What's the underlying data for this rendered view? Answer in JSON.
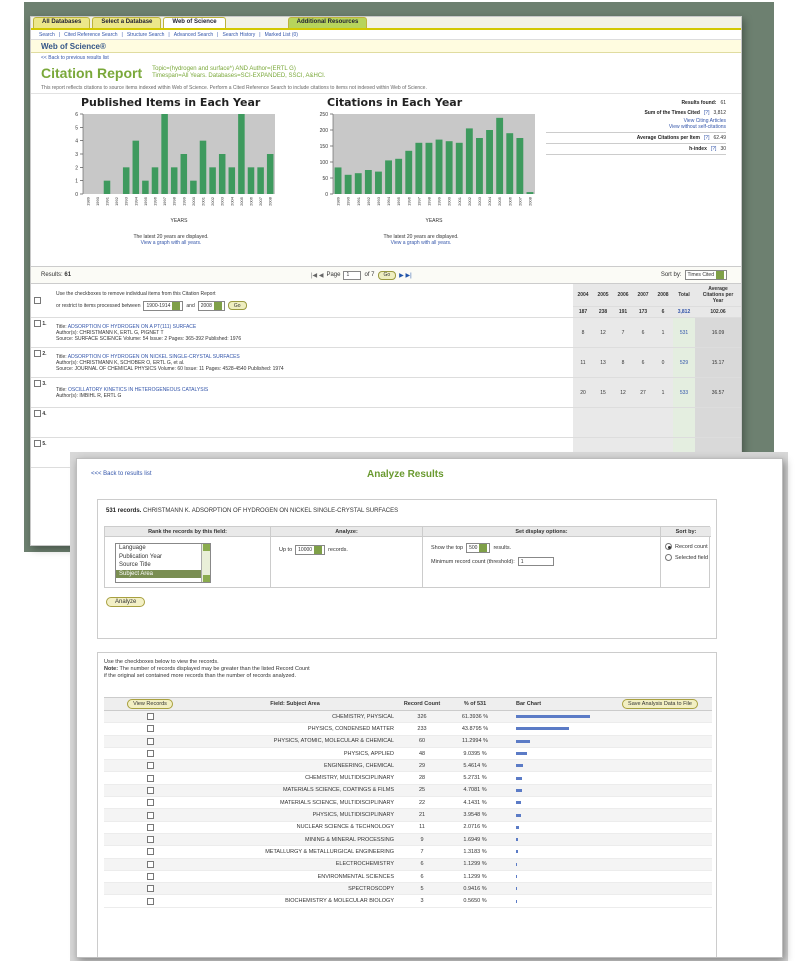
{
  "back": {
    "tabs": [
      "All Databases",
      "Select a Database",
      "Web of Science",
      "Additional Resources"
    ],
    "links": [
      "Search",
      "Cited Reference Search",
      "Structure Search",
      "Advanced Search",
      "Search History",
      "Marked List (0)"
    ],
    "section_title": "Web of Science®",
    "back_link": "<< Back to previous results list",
    "report_title": "Citation Report",
    "topic_line1": "Topic=(hydrogen and surface*) AND Author=(ERTL G)",
    "topic_line2": "Timespan=All Years. Databases=SCI-EXPANDED, SSCI, A&HCI.",
    "note": "This report reflects citations to source items indexed within Web of Science. Perform a Cited Reference Search to include citations to items not indexed within Web of Science.",
    "published": {
      "title": "Published Items in Each Year",
      "foot1": "The latest 20 years are displayed.",
      "foot2": "View a graph with all years.",
      "xlabel": "YEARS"
    },
    "citations": {
      "title": "Citations in Each Year",
      "foot1": "The latest 20 years are displayed.",
      "foot2": "View a graph with all years.",
      "xlabel": "YEARS"
    },
    "stats": {
      "results_label": "Results found:",
      "results_value": "61",
      "sum_label": "Sum of the Times Cited",
      "sum_link": "[?]",
      "sum_value": "3,812",
      "view_citing": "View Citing Articles",
      "view_without": "View without self-citations",
      "avg_label": "Average Citations per Item",
      "avg_link": "[?]",
      "avg_value": "62.49",
      "h_label": "h-index",
      "h_link": "[?]",
      "h_value": "30"
    },
    "pager": {
      "results_label": "Results:",
      "results_value": "61",
      "page_label": "Page",
      "page_value": "1",
      "of": "of 7",
      "go": "Go",
      "sort_label": "Sort by:",
      "sort_value": "Times Cited"
    },
    "table": {
      "years": [
        "2004",
        "2005",
        "2006",
        "2007",
        "2008"
      ],
      "total_label": "Total",
      "avg_label": "Average Citations per Year",
      "instr1": "Use the checkboxes to remove individual items from this Citation Report",
      "instr2": "or restrict to items processed between",
      "from_year": "1900-1914",
      "and": "and",
      "to_year": "2008",
      "go": "Go",
      "totals": [
        "187",
        "238",
        "191",
        "173",
        "6",
        "3,812",
        "102.06"
      ],
      "records": [
        {
          "num": "1.",
          "title_label": "Title:",
          "title": "ADSORPTION OF HYDROGEN ON A PT(111) SURFACE",
          "authors_label": "Author(s):",
          "authors": "CHRISTMANN K, ERTL G, PIGNET T",
          "source_label": "Source:",
          "source": "SURFACE SCIENCE Volume: 54 Issue: 2 Pages: 365-392 Published: 1976",
          "vals": [
            "8",
            "12",
            "7",
            "6",
            "1",
            "531",
            "16.09"
          ]
        },
        {
          "num": "2.",
          "title_label": "Title:",
          "title": "ADSORPTION OF HYDROGEN ON NICKEL SINGLE-CRYSTAL SURFACES",
          "authors_label": "Author(s):",
          "authors": "CHRISTMANN K, SCHOBER O, ERTL G, et al.",
          "source_label": "Source:",
          "source": "JOURNAL OF CHEMICAL PHYSICS Volume: 60 Issue: 11 Pages: 4528-4540 Published: 1974",
          "vals": [
            "11",
            "13",
            "8",
            "6",
            "0",
            "529",
            "15.17"
          ]
        },
        {
          "num": "3.",
          "title_label": "Title:",
          "title": "OSCILLATORY KINETICS IN HETEROGENEOUS CATALYSIS",
          "authors_label": "Author(s):",
          "authors": "IMBIHL R, ERTL G",
          "source_label": "",
          "source": "",
          "vals": [
            "20",
            "15",
            "12",
            "27",
            "1",
            "533",
            "36.57"
          ]
        },
        {
          "num": "4.",
          "title_label": "",
          "title": "",
          "authors_label": "",
          "authors": "",
          "source_label": "",
          "source": "",
          "vals": [
            "",
            "",
            "",
            "",
            "",
            "",
            ""
          ]
        },
        {
          "num": "5.",
          "title_label": "",
          "title": "",
          "authors_label": "",
          "authors": "",
          "source_label": "",
          "source": "",
          "vals": [
            "",
            "",
            "",
            "",
            "",
            "",
            ""
          ]
        }
      ]
    }
  },
  "chart_data": [
    {
      "type": "bar",
      "title": "Published Items in Each Year",
      "xlabel": "YEARS",
      "ylim": [
        0,
        6
      ],
      "yticks": [
        0,
        1,
        2,
        3,
        4,
        5,
        6
      ],
      "categories": [
        "1989",
        "1990",
        "1991",
        "1992",
        "1993",
        "1994",
        "1995",
        "1996",
        "1997",
        "1998",
        "1999",
        "2000",
        "2001",
        "2002",
        "2003",
        "2004",
        "2005",
        "2006",
        "2007",
        "2008"
      ],
      "values": [
        0,
        0,
        1,
        0,
        2,
        4,
        1,
        2,
        6,
        2,
        3,
        1,
        4,
        2,
        3,
        2,
        6,
        2,
        2,
        3
      ],
      "color": "#3e9a5e"
    },
    {
      "type": "bar",
      "title": "Citations in Each Year",
      "xlabel": "YEARS",
      "ylim": [
        0,
        250
      ],
      "yticks": [
        0,
        50,
        100,
        150,
        200,
        250
      ],
      "categories": [
        "1989",
        "1990",
        "1991",
        "1992",
        "1993",
        "1994",
        "1995",
        "1996",
        "1997",
        "1998",
        "1999",
        "2000",
        "2001",
        "2002",
        "2003",
        "2004",
        "2005",
        "2006",
        "2007",
        "2008"
      ],
      "values": [
        83,
        60,
        65,
        75,
        70,
        105,
        110,
        135,
        160,
        160,
        170,
        165,
        160,
        205,
        175,
        200,
        238,
        190,
        175,
        6
      ],
      "color": "#3e9a5e"
    }
  ],
  "front": {
    "back_link": "<<< Back to results list",
    "title": "Analyze Results",
    "summary_count": "531 records.",
    "summary_text": "CHRISTMANN K. ADSORPTION OF HYDROGEN ON NICKEL SINGLE-CRYSTAL SURFACES",
    "heads": [
      "Rank the records by this field:",
      "Analyze:",
      "Set display options:",
      "Sort by:"
    ],
    "fields": [
      "Language",
      "Publication Year",
      "Source Title",
      "Subject Area"
    ],
    "upto_label": "Up to",
    "upto_value": "10000",
    "records_word": "records.",
    "showtop_label": "Show the top",
    "showtop_value": "500",
    "results_word": "results.",
    "min_label": "Minimum record count (threshold):",
    "min_value": "1",
    "sort_opt1": "Record count",
    "sort_opt2": "Selected field",
    "analyze_btn": "Analyze",
    "note1": "Use the checkboxes below to view the records.",
    "note2_b": "Note:",
    "note2": "The number of records displayed may be greater than the listed Record Count",
    "note3": "if the original set contained more records than the number of records analyzed.",
    "col_view": "View Records",
    "col_field": "Field: Subject Area",
    "col_count": "Record Count",
    "col_pct": "% of 531",
    "col_bar": "Bar Chart",
    "col_save": "Save Analysis Data to File",
    "rows": [
      {
        "field": "CHEMISTRY, PHYSICAL",
        "count": "326",
        "pct": "61.3936 %",
        "frac": 0.614
      },
      {
        "field": "PHYSICS, CONDENSED MATTER",
        "count": "233",
        "pct": "43.8795 %",
        "frac": 0.439
      },
      {
        "field": "PHYSICS, ATOMIC, MOLECULAR & CHEMICAL",
        "count": "60",
        "pct": "11.2994 %",
        "frac": 0.113
      },
      {
        "field": "PHYSICS, APPLIED",
        "count": "48",
        "pct": "9.0395 %",
        "frac": 0.09
      },
      {
        "field": "ENGINEERING, CHEMICAL",
        "count": "29",
        "pct": "5.4614 %",
        "frac": 0.055
      },
      {
        "field": "CHEMISTRY, MULTIDISCIPLINARY",
        "count": "28",
        "pct": "5.2731 %",
        "frac": 0.053
      },
      {
        "field": "MATERIALS SCIENCE, COATINGS & FILMS",
        "count": "25",
        "pct": "4.7081 %",
        "frac": 0.047
      },
      {
        "field": "MATERIALS SCIENCE, MULTIDISCIPLINARY",
        "count": "22",
        "pct": "4.1431 %",
        "frac": 0.041
      },
      {
        "field": "PHYSICS, MULTIDISCIPLINARY",
        "count": "21",
        "pct": "3.9548 %",
        "frac": 0.04
      },
      {
        "field": "NUCLEAR SCIENCE & TECHNOLOGY",
        "count": "11",
        "pct": "2.0716 %",
        "frac": 0.021
      },
      {
        "field": "MINING & MINERAL PROCESSING",
        "count": "9",
        "pct": "1.6949 %",
        "frac": 0.017
      },
      {
        "field": "METALLURGY & METALLURGICAL ENGINEERING",
        "count": "7",
        "pct": "1.3183 %",
        "frac": 0.013
      },
      {
        "field": "ELECTROCHEMISTRY",
        "count": "6",
        "pct": "1.1299 %",
        "frac": 0.011
      },
      {
        "field": "ENVIRONMENTAL SCIENCES",
        "count": "6",
        "pct": "1.1299 %",
        "frac": 0.011
      },
      {
        "field": "SPECTROSCOPY",
        "count": "5",
        "pct": "0.9416 %",
        "frac": 0.009
      },
      {
        "field": "BIOCHEMISTRY & MOLECULAR BIOLOGY",
        "count": "3",
        "pct": "0.5650 %",
        "frac": 0.006
      }
    ],
    "bar_color": "#5b7bc6"
  }
}
